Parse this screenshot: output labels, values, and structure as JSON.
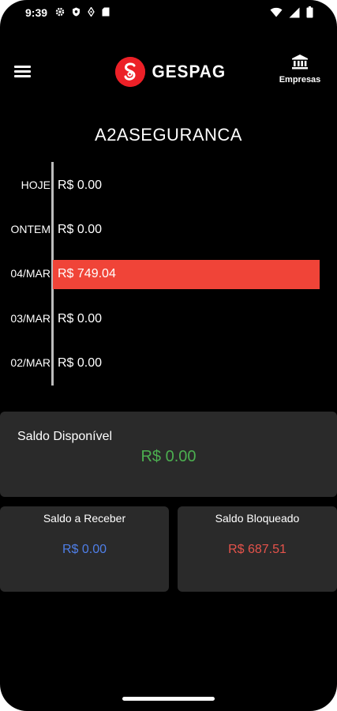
{
  "status_bar": {
    "time": "9:39",
    "left_icons": [
      "gear-icon",
      "shield-icon",
      "vpn-icon",
      "sd-card-icon"
    ],
    "right_icons": [
      "wifi-icon",
      "signal-icon",
      "battery-icon"
    ]
  },
  "app_bar": {
    "menu_icon": "hamburger-menu-icon",
    "logo_text": "GESPAG",
    "empresas_label": "Empresas",
    "empresas_icon": "bank-icon"
  },
  "company": {
    "name": "A2ASEGURANCA"
  },
  "history": [
    {
      "date": "HOJE",
      "value": "R$ 0.00",
      "highlighted": false
    },
    {
      "date": "ONTEM",
      "value": "R$ 0.00",
      "highlighted": false
    },
    {
      "date": "04/MAR",
      "value": "R$ 749.04",
      "highlighted": true
    },
    {
      "date": "03/MAR",
      "value": "R$ 0.00",
      "highlighted": false
    },
    {
      "date": "02/MAR",
      "value": "R$ 0.00",
      "highlighted": false
    }
  ],
  "balances": {
    "disponivel": {
      "title": "Saldo Disponível",
      "value": "R$ 0.00"
    },
    "a_receber": {
      "title": "Saldo a Receber",
      "value": "R$ 0.00"
    },
    "bloqueado": {
      "title": "Saldo Bloqueado",
      "value": "R$ 687.51"
    }
  },
  "colors": {
    "background": "#000000",
    "card": "#2a2a2a",
    "highlight": "#f04438",
    "brand": "#ec2027",
    "green": "#4caf50",
    "blue": "#4f7fe8",
    "red": "#e5534b"
  }
}
